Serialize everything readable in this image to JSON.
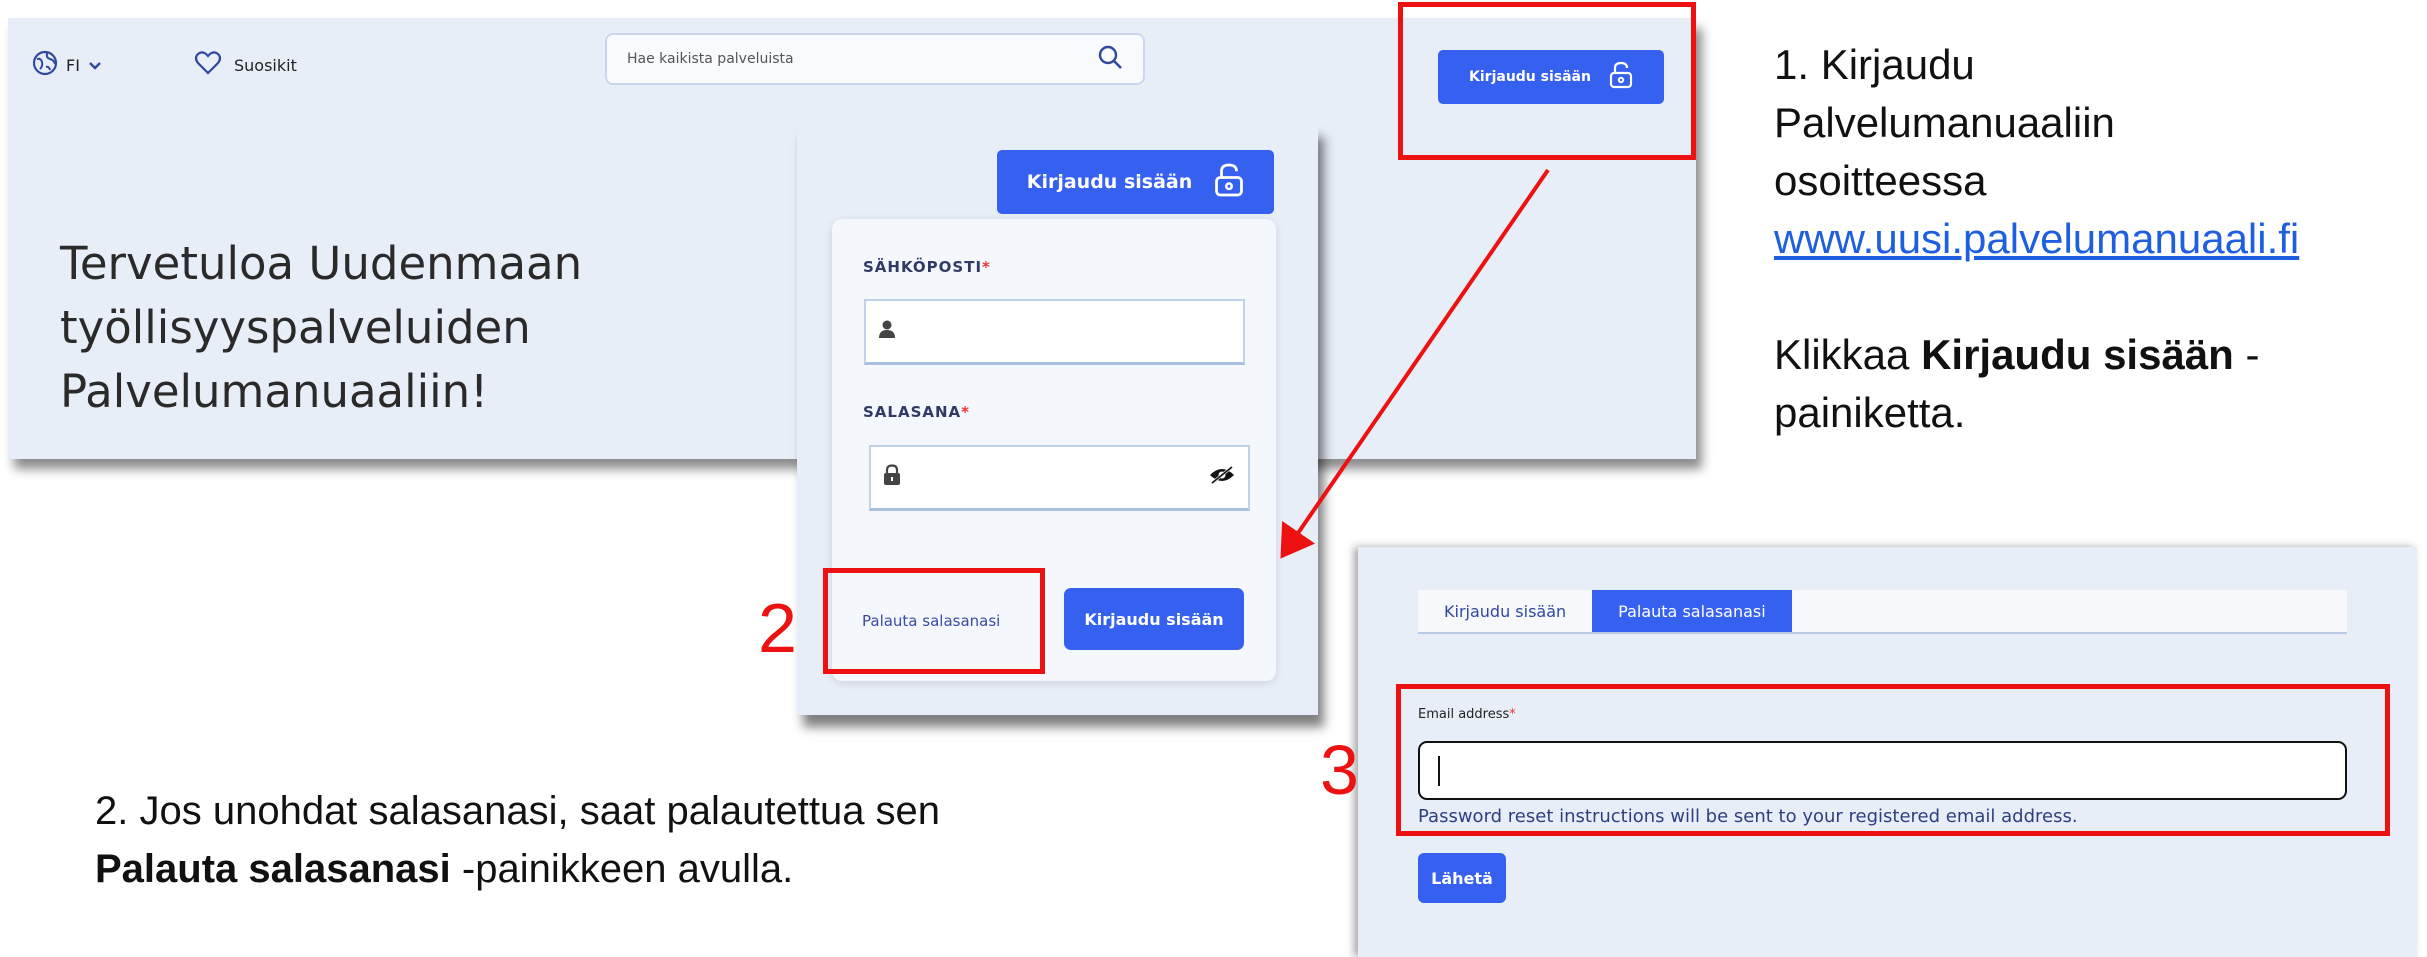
{
  "header": {
    "language": "FI",
    "favorites_label": "Suosikit",
    "search_placeholder": "Hae kaikista palveluista",
    "login_button": "Kirjaudu sisään"
  },
  "hero": {
    "title_lines": [
      "Tervetuloa Uudenmaan",
      "työllisyyspalveluiden",
      "Palvelumanuaaliin!"
    ]
  },
  "login_form": {
    "login_button_top": "Kirjaudu sisään",
    "email_label": "SÄHKÖPOSTI",
    "password_label": "SALASANA",
    "required_mark": "*",
    "reset_link": "Palauta salasanasi",
    "submit_button": "Kirjaudu sisään"
  },
  "reset_form": {
    "tabs": [
      {
        "label": "Kirjaudu sisään",
        "active": false
      },
      {
        "label": "Palauta salasanasi",
        "active": true
      }
    ],
    "email_label": "Email address",
    "required_mark": "*",
    "email_value": "",
    "help_text": "Password reset instructions will be sent to your registered email address.",
    "send_button": "Lähetä"
  },
  "annotations": {
    "step2_number": "2",
    "step3_number": "3",
    "instruction1": {
      "line1": "1. Kirjaudu",
      "line2": "Palvelumanuaaliin",
      "line3": "osoitteessa",
      "link": "www.uusi.palvelumanuaali.fi",
      "line5_pre": "Klikkaa ",
      "line5_bold": "Kirjaudu sisään",
      "line5_post": " -",
      "line6": "painiketta."
    },
    "instruction2": {
      "line1": "2. Jos unohdat salasanasi, saat palautettua sen",
      "line2_bold": "Palauta salasanasi",
      "line2_post": " -painikkeen avulla."
    }
  },
  "colors": {
    "primary": "#3660f0",
    "annotation_red": "#ee1111",
    "panel_bg": "#e8eef8"
  }
}
